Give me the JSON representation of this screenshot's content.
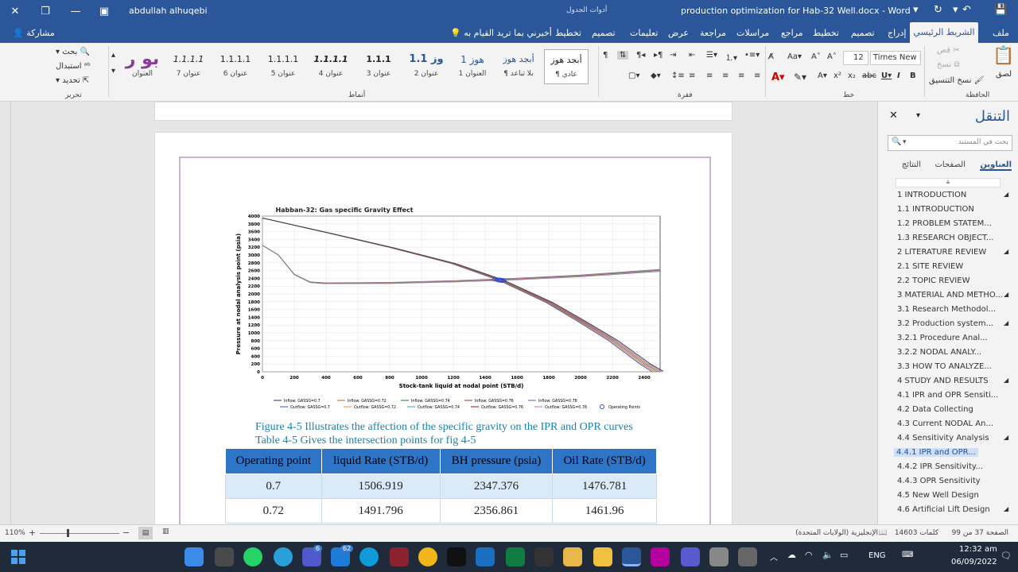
{
  "titlebar": {
    "user_name": "abdullah alhuqebi",
    "document_title": "production optimization for Hab-32 Well.docx  -  Word",
    "table_tools": "أدوات الجدول"
  },
  "tabs": {
    "share": "مشاركة",
    "tell_me": "أخبرني بما تريد القيام به",
    "layout": "تخطيط",
    "design_table": "تصميم",
    "help": "تعليمات",
    "view": "عرض",
    "review": "مراجعة",
    "mailings": "مراسلات",
    "references": "مراجع",
    "layout2": "تخطيط",
    "design": "تصميم",
    "insert": "إدراج",
    "home": "الشريط الرئيسي",
    "file": "ملف"
  },
  "ribbon": {
    "editing": {
      "find": "بحث",
      "replace": "استبدال",
      "select": "تحديد",
      "group": "تحرير"
    },
    "styles": {
      "group": "أنماط",
      "items": [
        {
          "preview": "بو ر",
          "name": "العنوان"
        },
        {
          "preview": "1.1.1.1",
          "name": "عنوان 7"
        },
        {
          "preview": "1.1.1.1",
          "name": "عنوان 6"
        },
        {
          "preview": "1.1.1.1",
          "name": "عنوان 5"
        },
        {
          "preview": "1.1.1.1",
          "name": "عنوان 4"
        },
        {
          "preview": "1.1.1",
          "name": "عنوان 3"
        },
        {
          "preview": "1.1 وز",
          "name": "عنوان 2"
        },
        {
          "preview": "1 هوز",
          "name": "العنوان 1"
        },
        {
          "preview": "أبجد هوز",
          "name": "¶ بلا تباعد"
        },
        {
          "preview": "أبجد هوز",
          "name": "¶ عادي"
        }
      ]
    },
    "paragraph": {
      "group": "فقرة"
    },
    "font": {
      "group": "خط",
      "size": "12",
      "family": "Times New Ro"
    },
    "clipboard": {
      "group": "الحافظة",
      "paste": "لصق",
      "cut": "قص",
      "copy": "نسخ",
      "format_painter": "نسخ التنسيق"
    }
  },
  "document": {
    "chart_title": "Habban-32: Gas specific Gravity Effect",
    "caption_1": "Figure 4-5 Illustrates the affection of the specific gravity on the IPR and OPR curves",
    "caption_2": "Table 4-5 Gives the intersection points for fig 4-5",
    "table": {
      "headers": [
        "Operating point",
        "liquid Rate (STB/d)",
        "BH pressure (psia)",
        "Oil Rate (STB/d)"
      ],
      "rows": [
        [
          "0.7",
          "1506.919",
          "2347.376",
          "1476.781"
        ],
        [
          "0.72",
          "1491.796",
          "2356.861",
          "1461.96"
        ]
      ]
    }
  },
  "chart_data": {
    "type": "line",
    "title": "Habban-32: Gas specific Gravity Effect",
    "xlabel": "Stock-tank liquid at nodal point (STB/d)",
    "ylabel": "Pressure at nodal analysis point (psia)",
    "xlim": [
      0,
      2500
    ],
    "ylim": [
      0,
      4000
    ],
    "xticks": [
      "0",
      "200",
      "400",
      "600",
      "800",
      "1000",
      "1200",
      "1400",
      "1600",
      "1800",
      "2000",
      "2200",
      "2400"
    ],
    "yticks": [
      "0",
      "200",
      "400",
      "600",
      "800",
      "1000",
      "1200",
      "1400",
      "1600",
      "1800",
      "2000",
      "2200",
      "2400",
      "2600",
      "2800",
      "3000",
      "3200",
      "3400",
      "3600",
      "3800",
      "4000"
    ],
    "grid": true,
    "legend_position": "bottom",
    "colors": {
      "inflow": [
        "#3b4fa0",
        "#e06a4a",
        "#4a8a4a",
        "#c94a4a",
        "#9a6ab0",
        "#3b3b3b"
      ],
      "outflow": [
        "#5a6fd0",
        "#f0a060",
        "#5ab0c0",
        "#a04040",
        "#d080c0",
        "#808080"
      ],
      "operating_points": "#2a4fd8"
    },
    "legend": [
      "Inflow: GASSG=0.7",
      "Inflow: GASSG=0.72",
      "Inflow: GASSG=0.74",
      "Inflow: GASSG=0.76",
      "Inflow: GASSG=0.78",
      "Outflow: GASSG=0.7",
      "Outflow: GASSG=0.72",
      "Outflow: GASSG=0.74",
      "Outflow: GASSG=0.76",
      "Outflow: GASSG=0.78",
      "Operating Points"
    ],
    "series": [
      {
        "name": "Inflow: GASSG=0.7",
        "x": [
          0,
          400,
          800,
          1200,
          1500,
          1800,
          2000,
          2200,
          2400,
          2480
        ],
        "y": [
          3950,
          3580,
          3200,
          2780,
          2350,
          1780,
          1300,
          800,
          200,
          0
        ]
      },
      {
        "name": "Outflow: GASSG=0.7",
        "x": [
          0,
          100,
          200,
          300,
          400,
          800,
          1200,
          1600,
          2000,
          2500
        ],
        "y": [
          3250,
          3000,
          2500,
          2300,
          2270,
          2280,
          2320,
          2380,
          2460,
          2600
        ]
      }
    ],
    "operating_points": {
      "x": [
        1506.919,
        1491.796
      ],
      "y": [
        2347.376,
        2356.861
      ]
    }
  },
  "navigation": {
    "title": "التنقل",
    "search_placeholder": "بحث في المستند",
    "tabs": [
      "العناوين",
      "الصفحات",
      "النتائج"
    ],
    "items": [
      "1 INTRODUCTION",
      "1.1 INTRODUCTION",
      "1.2 PROBLEM STATEM...",
      "1.3 RESEARCH OBJECT...",
      "2 LITERATURE REVIEW",
      "2.1 SITE REVIEW",
      "2.2  TOPIC REVIEW",
      "3 MATERIAL AND METHO...",
      "3.1 Research Methodol...",
      "3.2 Production system...",
      "3.2.1 Procedure Anal...",
      "3.2.2 NODAL ANALY...",
      "3.3 HOW TO ANALYZE...",
      "4 STUDY AND RESULTS",
      "4.1 IPR and OPR Sensiti...",
      "4.2 Data Collecting",
      "4.3  Current NODAL An...",
      "4.4  Sensitivity Analysis",
      "4.4.1 IPR and OPR...",
      "4.4.2  IPR Sensitivity...",
      "4.4.3  OPR Sensitivity",
      "4.5  New Well Design",
      "4.6 Artificial Lift Design"
    ]
  },
  "statusbar": {
    "page": "الصفحة 37 من 99",
    "words": "14603 كلمات",
    "language": "الإنجليزية (الولايات المتحدة)",
    "zoom": "110%"
  },
  "taskbar": {
    "time": "12:32 am",
    "date": "06/09/2022",
    "lang": "ENG",
    "badge_1": "6",
    "badge_2": "62"
  }
}
